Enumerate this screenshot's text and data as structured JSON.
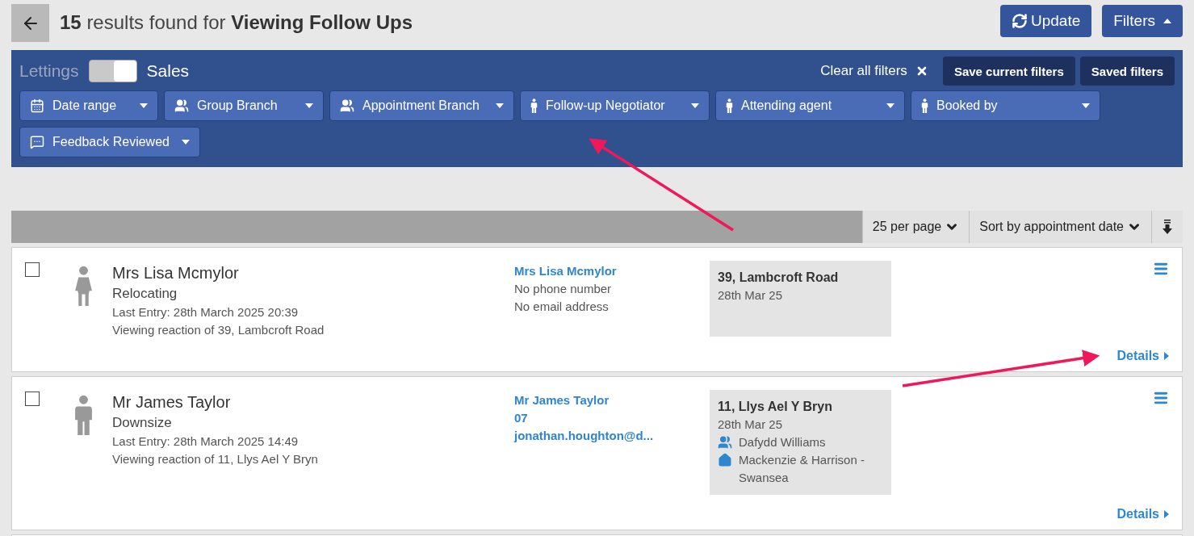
{
  "header": {
    "count": "15",
    "title": "results found for **Viewing Follow Ups**",
    "buttons": [
      {
        "kind": "update",
        "label": "Update"
      },
      {
        "kind": "filters",
        "label": "Filters"
      }
    ]
  },
  "filter_panel": {
    "mode_toggle": {
      "labels": [
        "Lettings",
        "Sales"
      ],
      "on": true
    },
    "clear_label": "Clear all filters",
    "actions": [
      "Save current filters",
      "Saved filters"
    ],
    "filters": [
      {
        "kind": "date",
        "label": "Date range"
      },
      {
        "kind": "group",
        "label": "Group Branch"
      },
      {
        "kind": "group",
        "label": "Appointment Branch"
      },
      {
        "kind": "person",
        "label": "Follow-up Negotiator"
      },
      {
        "kind": "person",
        "label": "Attending agent"
      },
      {
        "kind": "person",
        "label": "Booked by"
      },
      {
        "kind": "chat",
        "label": "Feedback Reviewed"
      }
    ]
  },
  "toolbar": {
    "per_page": "25 per page",
    "sort": "Sort by appointment date"
  },
  "results": [
    {
      "kind": "female",
      "checked": false,
      "name": "Mrs Lisa Mcmylor",
      "reason": "Relocating",
      "last_entry": "Last Entry: 28th March 2025 20:39",
      "reaction": "Viewing reaction of 39, Lambcroft Road",
      "contact": [
        {
          "text": "Mrs Lisa Mcmylor",
          "link": true
        },
        {
          "text": "No phone number",
          "link": false
        },
        {
          "text": "No email address",
          "link": false
        }
      ],
      "property": {
        "address": "39, Lambcroft Road",
        "date": "28th Mar 25"
      },
      "details": "Details"
    },
    {
      "kind": "male",
      "checked": false,
      "name": "Mr James Taylor",
      "reason": "Downsize",
      "last_entry": "Last Entry: 28th March 2025 14:49",
      "reaction": "Viewing reaction of 11, Llys Ael Y Bryn",
      "contact": [
        {
          "text": "Mr James Taylor",
          "link": true
        },
        {
          "text": "07",
          "link": true
        },
        {
          "text": "jonathan.houghton@d...",
          "link": true
        }
      ],
      "property": {
        "address": "11, Llys Ael Y Bryn",
        "date": "28th Mar 25",
        "agent": "Dafydd Williams",
        "branch": "Mackenzie & Harrison - Swansea"
      },
      "details": "Details"
    }
  ]
}
